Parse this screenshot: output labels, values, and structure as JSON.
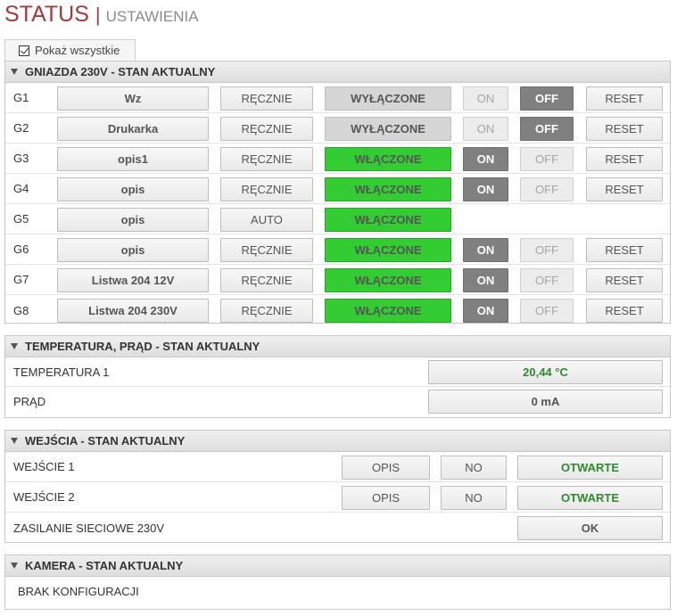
{
  "header": {
    "title": "STATUS",
    "separator": "|",
    "subtitle": "USTAWIENIA"
  },
  "show_all": {
    "label": "Pokaż wszystkie",
    "checked": true
  },
  "sockets": {
    "title": "GNIAZDA 230V - STAN AKTUALNY",
    "rows": [
      {
        "id": "G1",
        "name": "Wz",
        "mode": "RĘCZNIE",
        "state": "WYŁĄCZONE",
        "on": "ON",
        "off": "OFF",
        "reset": "RESET"
      },
      {
        "id": "G2",
        "name": "Drukarka",
        "mode": "RĘCZNIE",
        "state": "WYŁĄCZONE",
        "on": "ON",
        "off": "OFF",
        "reset": "RESET"
      },
      {
        "id": "G3",
        "name": "opis1",
        "mode": "RĘCZNIE",
        "state": "WŁĄCZONE",
        "on": "ON",
        "off": "OFF",
        "reset": "RESET"
      },
      {
        "id": "G4",
        "name": "opis",
        "mode": "RĘCZNIE",
        "state": "WŁĄCZONE",
        "on": "ON",
        "off": "OFF",
        "reset": "RESET"
      },
      {
        "id": "G5",
        "name": "opis",
        "mode": "AUTO",
        "state": "WŁĄCZONE"
      },
      {
        "id": "G6",
        "name": "opis",
        "mode": "RĘCZNIE",
        "state": "WŁĄCZONE",
        "on": "ON",
        "off": "OFF",
        "reset": "RESET"
      },
      {
        "id": "G7",
        "name": "Listwa 204 12V",
        "mode": "RĘCZNIE",
        "state": "WŁĄCZONE",
        "on": "ON",
        "off": "OFF",
        "reset": "RESET"
      },
      {
        "id": "G8",
        "name": "Listwa 204 230V",
        "mode": "RĘCZNIE",
        "state": "WŁĄCZONE",
        "on": "ON",
        "off": "OFF",
        "reset": "RESET"
      }
    ]
  },
  "temperature": {
    "title": "TEMPERATURA, PRĄD - STAN AKTUALNY",
    "rows": [
      {
        "label": "TEMPERATURA 1",
        "value": "20,44 °C"
      },
      {
        "label": "PRĄD",
        "value": "0 mA"
      }
    ]
  },
  "inputs": {
    "title": "WEJŚCIA - STAN AKTUALNY",
    "rows": [
      {
        "label": "WEJŚCIE 1",
        "desc": "OPIS",
        "type": "NO",
        "state": "OTWARTE"
      },
      {
        "label": "WEJŚCIE 2",
        "desc": "OPIS",
        "type": "NO",
        "state": "OTWARTE"
      },
      {
        "label": "ZASILANIE SIECIOWE 230V",
        "state": "OK"
      }
    ]
  },
  "camera": {
    "title": "KAMERA - STAN AKTUALNY",
    "message": "BRAK KONFIGURACJI"
  },
  "colors": {
    "title_red": "#a33a3a",
    "on_green": "#33cc33",
    "dark_gray": "#808080",
    "value_green": "#2e8a2e"
  }
}
